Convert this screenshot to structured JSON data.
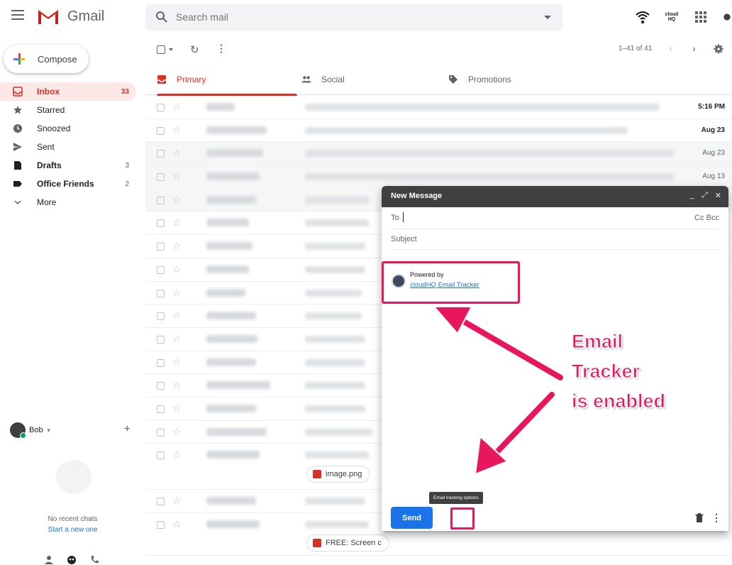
{
  "topbar": {
    "brand": "Gmail",
    "search_placeholder": "Search mail",
    "cloudhq_label": "cloud HQ"
  },
  "compose_button": "Compose",
  "nav": [
    {
      "label": "Inbox",
      "count": "33",
      "icon": "inbox-icon",
      "active": true
    },
    {
      "label": "Starred",
      "count": "",
      "icon": "star-icon"
    },
    {
      "label": "Snoozed",
      "count": "",
      "icon": "clock-icon"
    },
    {
      "label": "Sent",
      "count": "",
      "icon": "send-icon"
    },
    {
      "label": "Drafts",
      "count": "3",
      "icon": "draft-icon",
      "bold": true
    },
    {
      "label": "Office Friends",
      "count": "2",
      "icon": "label-icon",
      "bold": true
    },
    {
      "label": "More",
      "count": "",
      "icon": "chevron-down-icon"
    }
  ],
  "chat": {
    "user": "Bob",
    "no_chats": "No recent chats",
    "start_new": "Start a new one"
  },
  "toolbar": {
    "pager": "1–41 of 41"
  },
  "tabs": [
    {
      "label": "Primary",
      "icon": "inbox-icon"
    },
    {
      "label": "Social",
      "icon": "people-icon"
    },
    {
      "label": "Promotions",
      "icon": "tag-icon"
    }
  ],
  "emails": [
    {
      "date": "5:16 PM",
      "unread": true
    },
    {
      "date": "Aug 23",
      "unread": true
    },
    {
      "date": "Aug 23",
      "unread": false
    },
    {
      "date": "Aug 13",
      "unread": false
    },
    {
      "date": "",
      "unread": false
    },
    {
      "date": "",
      "unread": false
    },
    {
      "date": "",
      "unread": false
    },
    {
      "date": "",
      "unread": false
    },
    {
      "date": "",
      "unread": false
    },
    {
      "date": "",
      "unread": false
    },
    {
      "date": "",
      "unread": false
    },
    {
      "date": "",
      "unread": false
    },
    {
      "date": "",
      "unread": false
    },
    {
      "date": "",
      "unread": false
    },
    {
      "date": "",
      "unread": false
    },
    {
      "date": "",
      "unread": false
    }
  ],
  "attachments": {
    "image": "image.png",
    "youtube": "FREE: Screen c"
  },
  "compose_window": {
    "title": "New Message",
    "to_label": "To",
    "cc_bcc": "Cc Bcc",
    "subject_placeholder": "Subject",
    "powered_by": "Powered by",
    "powered_link": "cloudHQ Email Tracker",
    "send_label": "Send",
    "tooltip": "Email tracking options"
  },
  "callout": {
    "line1": "Email",
    "line2": "Tracker",
    "line3": "is enabled"
  },
  "colors": {
    "accent": "#d93025",
    "highlight": "#e8175d",
    "primary_blue": "#1a73e8"
  }
}
